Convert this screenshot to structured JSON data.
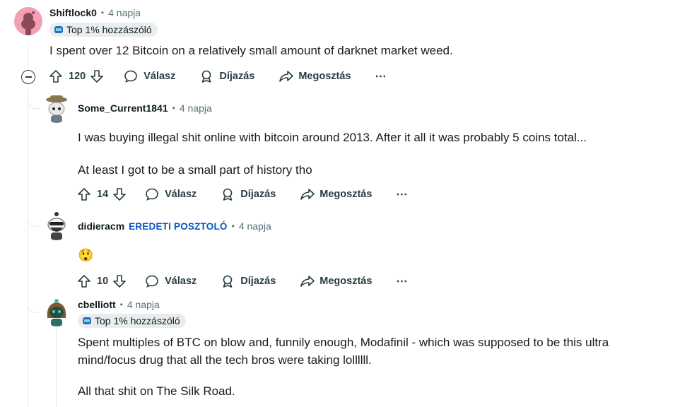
{
  "comments": [
    {
      "author": "Shiftlock0",
      "time": "4 napja",
      "flair": "Top 1% hozzászóló",
      "body": [
        "I spent over 12 Bitcoin on a relatively small amount of darknet market weed."
      ],
      "score": "120",
      "reply": "Válasz",
      "award": "Díjazás",
      "share": "Megosztás",
      "more": "⋯"
    },
    {
      "author": "Some_Current1841",
      "time": "4 napja",
      "body": [
        "I was buying illegal shit online with bitcoin around 2013. After it all it was probably 5 coins total...",
        "At least I got to be a small part of history tho"
      ],
      "score": "14",
      "reply": "Válasz",
      "award": "Díjazás",
      "share": "Megosztás",
      "more": "⋯"
    },
    {
      "author": "didieracm",
      "op_label": "EREDETI POSZTOLÓ",
      "time": "4 napja",
      "body": [
        "😲"
      ],
      "score": "10",
      "reply": "Válasz",
      "award": "Díjazás",
      "share": "Megosztás",
      "more": "⋯"
    },
    {
      "author": "cbelliott",
      "time": "4 napja",
      "flair": "Top 1% hozzászóló",
      "body": [
        "Spent multiples of BTC on blow and, funnily enough, Modafinil - which was supposed to be this ultra",
        "mind/focus drug that all the tech bros were taking lollllll.",
        "All that shit on The Silk Road."
      ]
    }
  ],
  "separator": "•",
  "colors": {
    "op": "#0a54c4",
    "meta": "#576f76",
    "flair_bg": "#eaedef",
    "line": "#e5ebee"
  }
}
